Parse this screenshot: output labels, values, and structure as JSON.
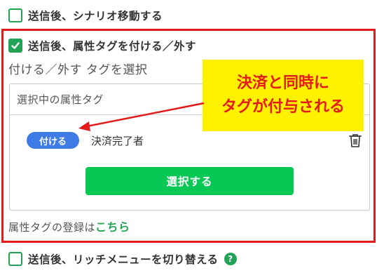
{
  "options": [
    {
      "label": "送信後、シナリオ移動する",
      "checked": false
    },
    {
      "label": "送信後、属性タグを付ける／外す",
      "checked": true
    },
    {
      "label": "送信後、リッチメニューを切り替える",
      "checked": false
    }
  ],
  "tag_section": {
    "title": "付ける／外す タグを選択",
    "box_header": "選択中の属性タグ",
    "selected_tags": [
      {
        "action_badge": "付ける",
        "name": "決済完了者",
        "icon": "trash-icon"
      }
    ],
    "select_button": "選択する",
    "register_prefix": "属性タグの登録は",
    "register_link": "こちら"
  },
  "callout": {
    "line1": "決済と同時に",
    "line2": "タグが付与される"
  },
  "help_icon_text": "?",
  "colors": {
    "green": "#22a356",
    "button_green": "#07c755",
    "badge_blue": "#3f7be6",
    "highlight_red": "#e51a1a",
    "callout_yellow": "#fff200"
  }
}
